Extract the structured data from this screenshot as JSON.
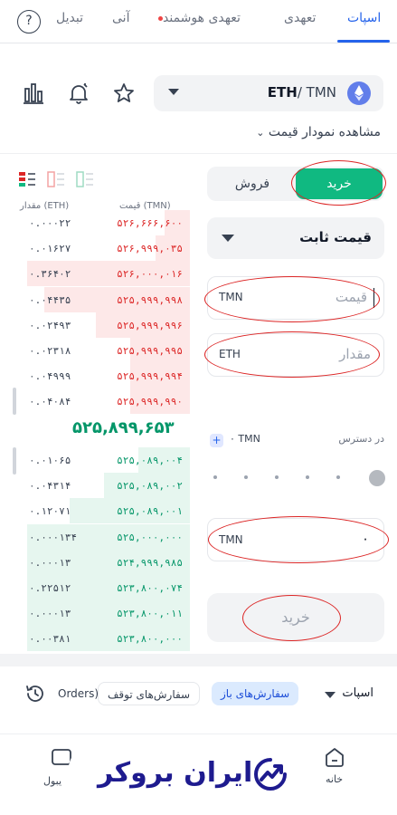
{
  "top_tabs": {
    "spot": "اسپات",
    "futures": "تعهدی",
    "smart_futures": "تعهدی هوشمند",
    "instant": "آنی",
    "convert": "تبدیل",
    "help": "?"
  },
  "pair": {
    "base": "ETH",
    "separator": "/ ",
    "quote": "TMN"
  },
  "chart_link": "مشاهده نمودار قیمت",
  "order_book": {
    "header_price": "قیمت (TMN)",
    "header_amount": "مقدار (ETH)",
    "asks": [
      {
        "price": "۵۲۶,۶۶۶,۶۰۰",
        "amount": "۰.۰۰۰۲۲"
      },
      {
        "price": "۵۲۶,۹۹۹,۰۳۵",
        "amount": "۰.۰۱۶۲۷"
      },
      {
        "price": "۵۲۶,۰۰۰,۰۱۶",
        "amount": "۰.۳۶۴۰۲"
      },
      {
        "price": "۵۲۵,۹۹۹,۹۹۸",
        "amount": "۰.۰۴۴۳۵"
      },
      {
        "price": "۵۲۵,۹۹۹,۹۹۶",
        "amount": "۰.۰۲۴۹۳"
      },
      {
        "price": "۵۲۵,۹۹۹,۹۹۵",
        "amount": "۰.۰۲۳۱۸"
      },
      {
        "price": "۵۲۵,۹۹۹,۹۹۴",
        "amount": "۰.۰۴۹۹۹"
      },
      {
        "price": "۵۲۵,۹۹۹,۹۹۰",
        "amount": "۰.۰۴۰۸۴"
      }
    ],
    "last_price": "۵۲۵,۸۹۹,۶۵۳",
    "bids": [
      {
        "price": "۵۲۵,۰۸۹,۰۰۴",
        "amount": "۰.۰۱۰۶۵"
      },
      {
        "price": "۵۲۵,۰۸۹,۰۰۲",
        "amount": "۰.۰۴۳۱۴"
      },
      {
        "price": "۵۲۵,۰۸۹,۰۰۱",
        "amount": "۰.۱۲۰۷۱"
      },
      {
        "price": "۵۲۵,۰۰۰,۰۰۰",
        "amount": "۰.۰۰۰۱۳۴"
      },
      {
        "price": "۵۲۴,۹۹۹,۹۸۵",
        "amount": "۰.۰۰۰۱۳"
      },
      {
        "price": "۵۲۳,۸۰۰,۰۷۴",
        "amount": "۰.۲۲۵۱۲"
      },
      {
        "price": "۵۲۳,۸۰۰,۰۱۱",
        "amount": "۰.۰۰۰۱۳"
      },
      {
        "price": "۵۲۳,۸۰۰,۰۰۰",
        "amount": "۰.۰۰۳۸۱"
      }
    ]
  },
  "trade": {
    "buy_label": "خرید",
    "sell_label": "فروش",
    "order_type": "قیمت ثابت",
    "price_placeholder": "قیمت",
    "price_unit": "TMN",
    "amount_placeholder": "مقدار",
    "amount_unit": "ETH",
    "available_label": "در دسترس",
    "available_value": "۰ TMN",
    "plus": "+",
    "total_unit": "TMN",
    "total_value": "۰",
    "submit_label": "خرید"
  },
  "orders": {
    "open_orders": "سفارش‌های باز",
    "stop_orders": "سفارش‌های توقف",
    "other_orders": "Orders)",
    "market_select": "اسپات"
  },
  "bottom_nav": {
    "home": "خانه",
    "wallet": "یبول"
  },
  "watermark": "ایران بروکر",
  "colors": {
    "accent": "#2563eb",
    "buy": "#10b981",
    "ask": "#dc2626",
    "bid": "#059669",
    "annotation": "#dc2626"
  }
}
